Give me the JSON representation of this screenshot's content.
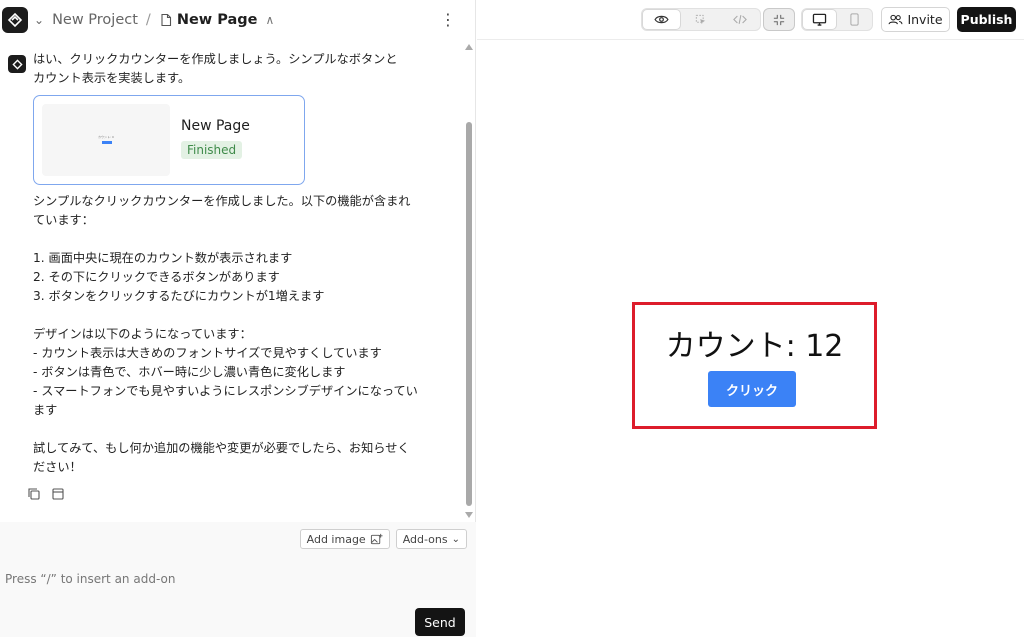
{
  "header": {
    "project": "New Project",
    "separator": "/",
    "page": "New Page"
  },
  "chat": {
    "message1": "はい、クリックカウンターを作成しましょう。シンプルなボタンと\nカウント表示を実装します。",
    "card": {
      "title": "New Page",
      "status": "Finished"
    },
    "message2": "シンプルなクリックカウンターを作成しました。以下の機能が含まれ\nています：\n\n1. 画面中央に現在のカウント数が表示されます\n2. その下にクリックできるボタンがあります\n3. ボタンをクリックするたびにカウントが1増えます\n\nデザインは以下のようになっています：\n- カウント表示は大きめのフォントサイズで見やすくしています\n- ボタンは青色で、ホバー時に少し濃い青色に変化します\n- スマートフォンでも見やすいようにレスポンシブデザインになってい\nます\n\n試してみて、もし何か追加の機能や変更が必要でしたら、お知らせく\nださい！"
  },
  "composer": {
    "add_image": "Add image",
    "add_ons": "Add-ons",
    "placeholder": "Press “/” to insert an add-on",
    "send": "Send"
  },
  "toolbar": {
    "invite": "Invite",
    "publish": "Publish"
  },
  "preview": {
    "counter_text": "カウント: 12",
    "button_label": "クリック"
  },
  "colors": {
    "accent_blue": "#3b82f6",
    "highlight_red": "#dd1c2b",
    "finished_green": "#3f8b4a"
  }
}
